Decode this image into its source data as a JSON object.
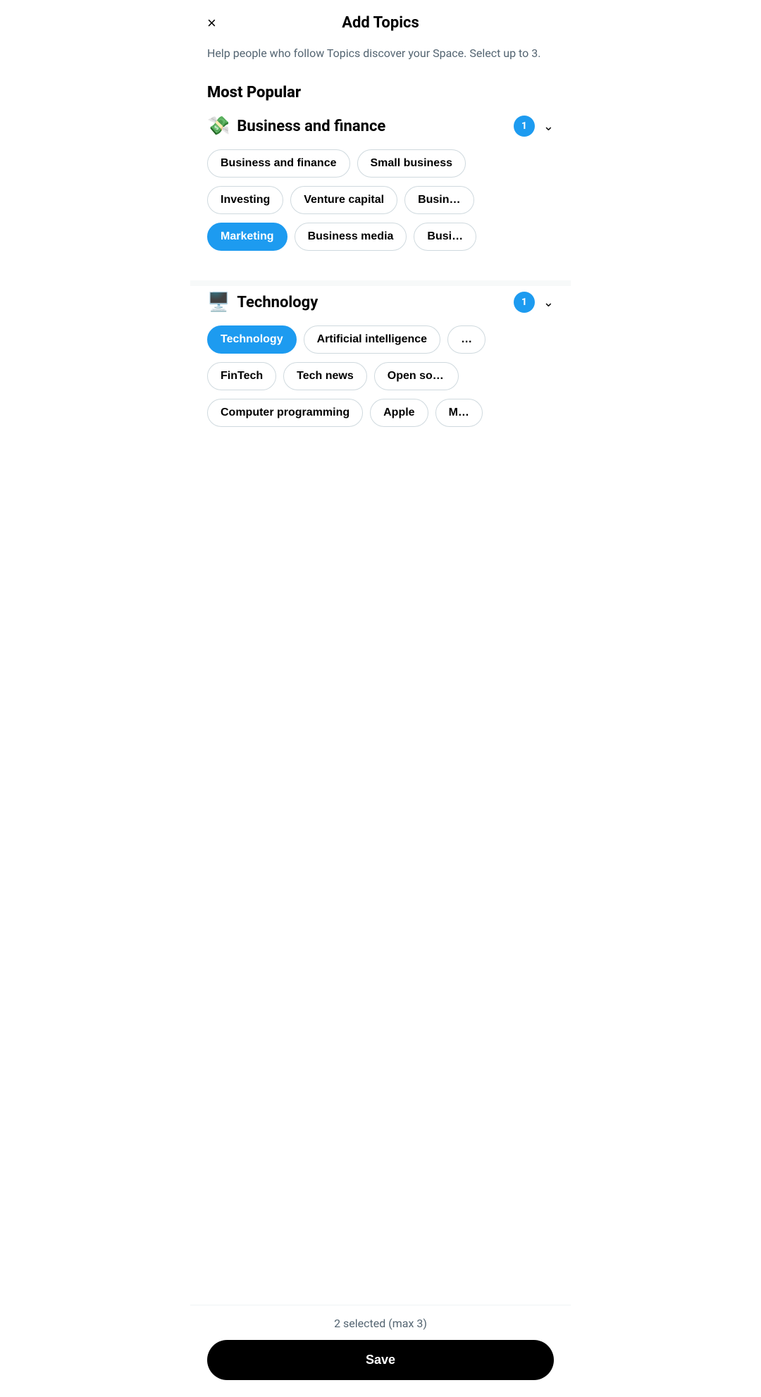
{
  "header": {
    "title": "Add Topics",
    "close_label": "×"
  },
  "subtitle": "Help people who follow Topics discover your Space. Select up to 3.",
  "most_popular_label": "Most Popular",
  "categories": [
    {
      "id": "business",
      "emoji": "💸",
      "name": "Business and finance",
      "badge": "1",
      "rows": [
        [
          {
            "label": "Business and finance",
            "selected": false,
            "partial": false
          },
          {
            "label": "Small business",
            "selected": false,
            "partial": false
          }
        ],
        [
          {
            "label": "Investing",
            "selected": false,
            "partial": false
          },
          {
            "label": "Venture capital",
            "selected": false,
            "partial": false
          },
          {
            "label": "Busin…",
            "selected": false,
            "partial": true
          }
        ],
        [
          {
            "label": "Marketing",
            "selected": true,
            "partial": false
          },
          {
            "label": "Business media",
            "selected": false,
            "partial": false
          },
          {
            "label": "Busi…",
            "selected": false,
            "partial": true
          }
        ]
      ]
    },
    {
      "id": "technology",
      "emoji": "🖥️",
      "name": "Technology",
      "badge": "1",
      "rows": [
        [
          {
            "label": "Technology",
            "selected": true,
            "partial": false
          },
          {
            "label": "Artificial intelligence",
            "selected": false,
            "partial": false
          },
          {
            "label": "…",
            "selected": false,
            "partial": true
          }
        ],
        [
          {
            "label": "FinTech",
            "selected": false,
            "partial": false
          },
          {
            "label": "Tech news",
            "selected": false,
            "partial": false
          },
          {
            "label": "Open source",
            "selected": false,
            "partial": true
          }
        ],
        [
          {
            "label": "Computer programming",
            "selected": false,
            "partial": false
          },
          {
            "label": "Apple",
            "selected": false,
            "partial": false
          },
          {
            "label": "M…",
            "selected": false,
            "partial": true
          }
        ]
      ]
    }
  ],
  "footer": {
    "selected_count": "2 selected (max 3)",
    "save_label": "Save"
  }
}
